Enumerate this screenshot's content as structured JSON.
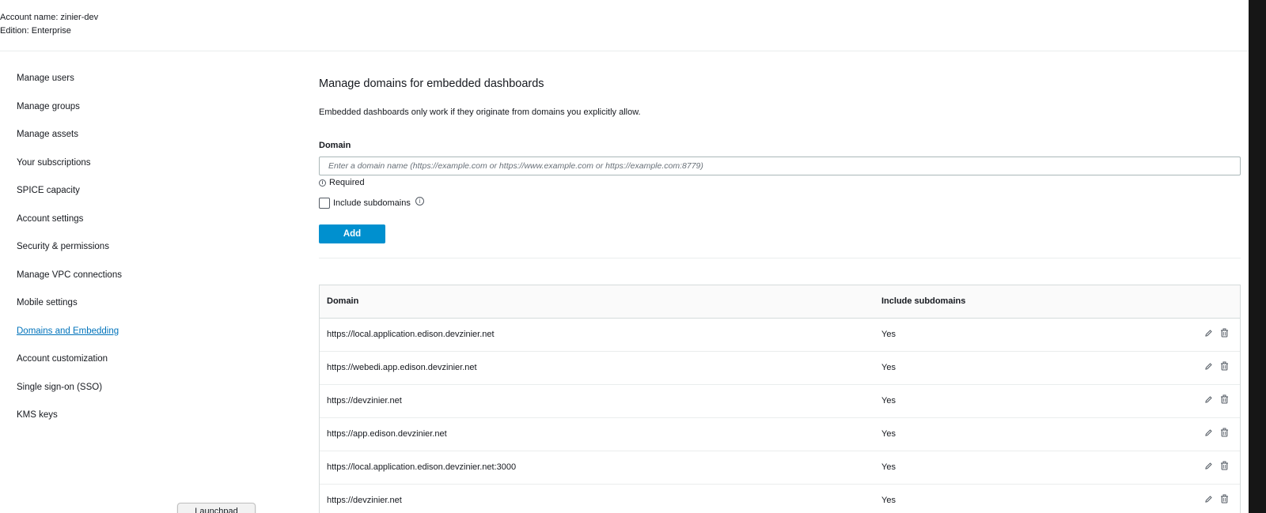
{
  "account": {
    "name_line": "Account name: zinier-dev",
    "edition_line": "Edition: Enterprise"
  },
  "sidebar": {
    "items": [
      {
        "label": "Manage users"
      },
      {
        "label": "Manage groups"
      },
      {
        "label": "Manage assets"
      },
      {
        "label": "Your subscriptions"
      },
      {
        "label": "SPICE capacity"
      },
      {
        "label": "Account settings"
      },
      {
        "label": "Security & permissions"
      },
      {
        "label": "Manage VPC connections"
      },
      {
        "label": "Mobile settings"
      },
      {
        "label": "Domains and Embedding"
      },
      {
        "label": "Account customization"
      },
      {
        "label": "Single sign-on (SSO)"
      },
      {
        "label": "KMS keys"
      }
    ],
    "active_item": "Domains and Embedding"
  },
  "main": {
    "title": "Manage domains for embedded dashboards",
    "description": "Embedded dashboards only work if they originate from domains you explicitly allow.",
    "domain_field": {
      "label": "Domain",
      "value": "",
      "placeholder": "Enter a domain name (https://example.com or https://www.example.com or https://example.com:8779)",
      "required_text": "Required"
    },
    "include_subdomains": {
      "label": "Include subdomains",
      "checked": false
    },
    "add_button_label": "Add"
  },
  "table": {
    "headers": {
      "domain": "Domain",
      "include_subdomains": "Include subdomains"
    },
    "rows": [
      {
        "domain": "https://local.application.edison.devzinier.net",
        "include_subdomains": "Yes"
      },
      {
        "domain": "https://webedi.app.edison.devzinier.net",
        "include_subdomains": "Yes"
      },
      {
        "domain": "https://devzinier.net",
        "include_subdomains": "Yes"
      },
      {
        "domain": "https://app.edison.devzinier.net",
        "include_subdomains": "Yes"
      },
      {
        "domain": "https://local.application.edison.devzinier.net:3000",
        "include_subdomains": "Yes"
      },
      {
        "domain": "https://devzinier.net",
        "include_subdomains": "Yes"
      }
    ],
    "row_actions": [
      "pencil-icon",
      "trash-icon"
    ]
  },
  "dock_tooltip": "Launchpad",
  "colors": {
    "accent": "#0090cf",
    "link": "#0073bb",
    "text": "#16191f",
    "border": "#d5dbdb"
  }
}
